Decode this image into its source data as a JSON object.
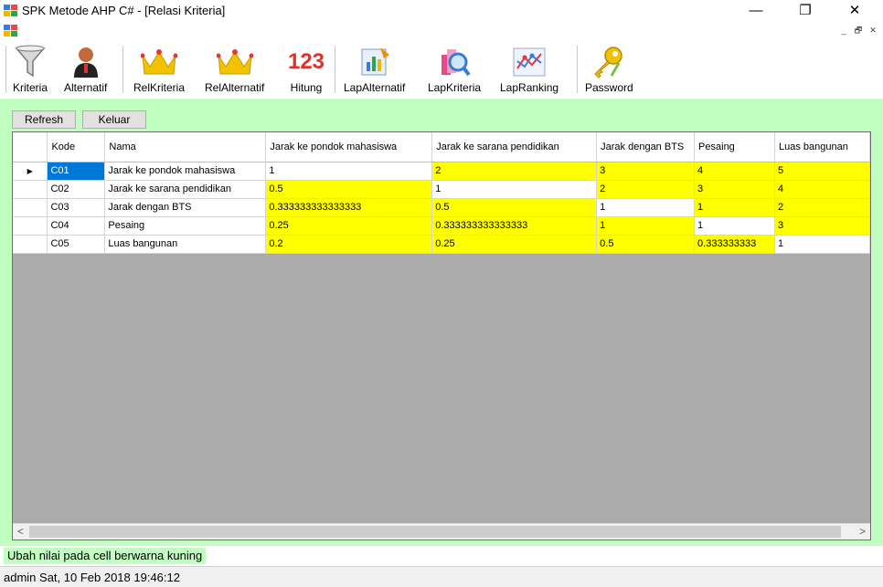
{
  "window": {
    "title": "SPK Metode AHP C# - [Relasi Kriteria]",
    "minimize": "—",
    "maximize": "❐",
    "close": "✕"
  },
  "mdi": {
    "minimize": "_",
    "restore": "🗗",
    "close": "✕"
  },
  "toolbar": {
    "kriteria": "Kriteria",
    "alternatif": "Alternatif",
    "relkriteria": "RelKriteria",
    "relalternatif": "RelAlternatif",
    "hitung": "Hitung",
    "hitung_icon_text": "123",
    "lapalternatif": "LapAlternatif",
    "lapkriteria": "LapKriteria",
    "lapranking": "LapRanking",
    "password": "Password"
  },
  "buttons": {
    "refresh": "Refresh",
    "keluar": "Keluar"
  },
  "grid": {
    "headers": {
      "kode": "Kode",
      "nama": "Nama",
      "c1": "Jarak ke pondok mahasiswa",
      "c2": "Jarak ke sarana pendidikan",
      "c3": "Jarak dengan BTS",
      "c4": "Pesaing",
      "c5": "Luas bangunan"
    },
    "current_row_marker": "▶",
    "rows": [
      {
        "kode": "C01",
        "nama": "Jarak ke pondok mahasiswa",
        "v": [
          "1",
          "2",
          "3",
          "4",
          "5"
        ]
      },
      {
        "kode": "C02",
        "nama": "Jarak ke sarana pendidikan",
        "v": [
          "0.5",
          "1",
          "2",
          "3",
          "4"
        ]
      },
      {
        "kode": "C03",
        "nama": "Jarak dengan BTS",
        "v": [
          "0.333333333333333",
          "0.5",
          "1",
          "1",
          "2"
        ]
      },
      {
        "kode": "C04",
        "nama": "Pesaing",
        "v": [
          "0.25",
          "0.333333333333333",
          "1",
          "1",
          "3"
        ]
      },
      {
        "kode": "C05",
        "nama": "Luas bangunan",
        "v": [
          "0.2",
          "0.25",
          "0.5",
          "0.333333333",
          "1"
        ]
      }
    ],
    "scroll_left": "<",
    "scroll_right": ">"
  },
  "status": {
    "message": "Ubah nilai pada cell berwarna kuning"
  },
  "footer": {
    "text": "admin Sat, 10 Feb 2018 19:46:12"
  },
  "colors": {
    "editable_cell": "#ffff00",
    "background": "#c0ffc0",
    "selection": "#0078d7"
  }
}
